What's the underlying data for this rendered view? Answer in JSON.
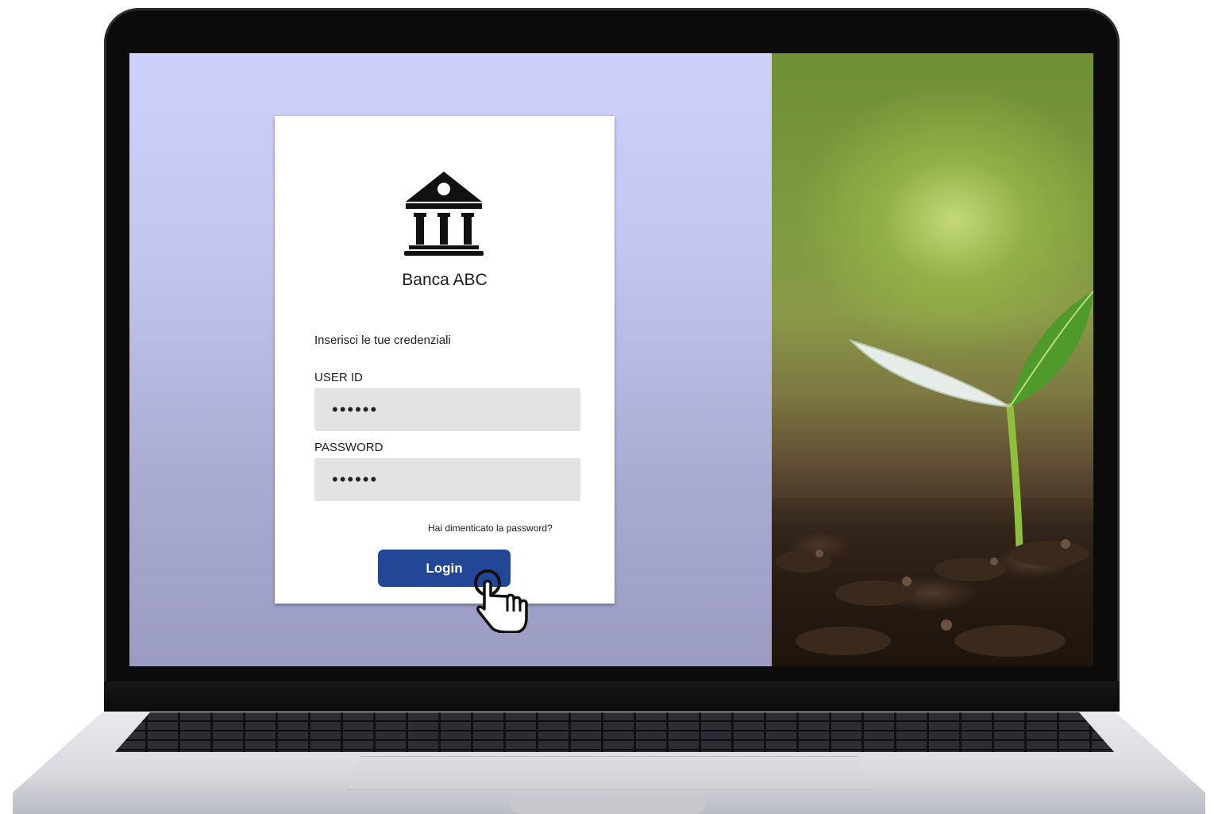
{
  "bank": {
    "name": "Banca ABC",
    "logo_icon": "bank-building-icon"
  },
  "login_form": {
    "instructions": "Inserisci le tue credenziali",
    "user_id_label": "USER ID",
    "user_id_value": "••••••",
    "password_label": "PASSWORD",
    "password_value": "••••••",
    "forgot_password": "Hai dimenticato la password?",
    "login_button": "Login"
  },
  "cursor": {
    "icon": "hand-pointer-icon"
  },
  "colors": {
    "button": "#234796",
    "field_background": "#e3e3e3",
    "screen_background": "#c9cdf3"
  }
}
